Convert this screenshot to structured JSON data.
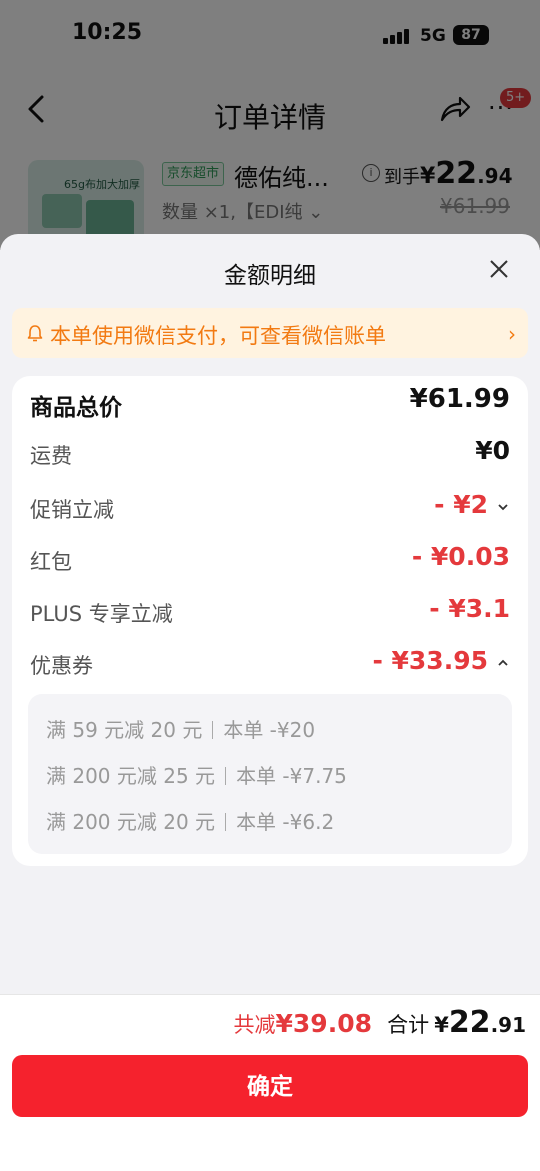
{
  "status_bar": {
    "time": "10:25",
    "network": "5G",
    "battery": "87"
  },
  "nav": {
    "title": "订单详情",
    "badge": "5+"
  },
  "product": {
    "thumb_text": "65g布加大加厚",
    "market_tag": "京东超市",
    "name": "德佑纯...",
    "spec": "数量 ×1,【EDI纯 ⌄",
    "daoshou_label": "到手",
    "daoshou_currency": "¥",
    "daoshou_int": "22",
    "daoshou_dec": ".94",
    "original_price": "¥61.99"
  },
  "sheet": {
    "title": "金额明细",
    "notice": "本单使用微信支付，可查看微信账单",
    "rows": [
      {
        "label": "商品总价",
        "value": "¥61.99"
      },
      {
        "label": "运费",
        "value": "¥0"
      },
      {
        "label": "促销立减",
        "value": "- ¥2"
      },
      {
        "label": "红包",
        "value": "- ¥0.03"
      },
      {
        "label": "PLUS 专享立减",
        "value": "- ¥3.1"
      },
      {
        "label": "优惠券",
        "value": "- ¥33.95"
      }
    ],
    "coupons": [
      {
        "rule": "满 59 元减 20 元",
        "amount": "本单 -¥20"
      },
      {
        "rule": "满 200 元减 25 元",
        "amount": "本单 -¥7.75"
      },
      {
        "rule": "满 200 元减 20 元",
        "amount": "本单 -¥6.2"
      }
    ]
  },
  "footer": {
    "saved_label": "共减",
    "saved_amount": "¥39.08",
    "total_label": "合计",
    "total_currency": "¥",
    "total_int": "22",
    "total_dec": ".91",
    "confirm_label": "确定"
  },
  "colors": {
    "accent_red": "#e4393c",
    "button_red": "#f5222d",
    "notice_orange": "#f27a12",
    "notice_bg": "#fff3e0"
  },
  "icons": [
    "back-arrow-icon",
    "share-icon",
    "more-icon",
    "info-icon",
    "close-icon",
    "bell-icon",
    "chevron-right-icon",
    "chevron-down-icon",
    "chevron-up-icon"
  ]
}
